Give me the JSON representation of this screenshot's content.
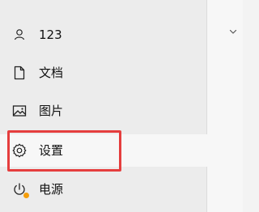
{
  "menu": {
    "items": [
      {
        "id": "user",
        "label": "123",
        "icon": "user-icon"
      },
      {
        "id": "documents",
        "label": "文档",
        "icon": "document-icon"
      },
      {
        "id": "pictures",
        "label": "图片",
        "icon": "picture-icon"
      },
      {
        "id": "settings",
        "label": "设置",
        "icon": "gear-icon",
        "active": true
      },
      {
        "id": "power",
        "label": "电源",
        "icon": "power-icon"
      }
    ]
  },
  "colors": {
    "highlight": "#e53e3e",
    "power_badge": "#f59e0b"
  }
}
